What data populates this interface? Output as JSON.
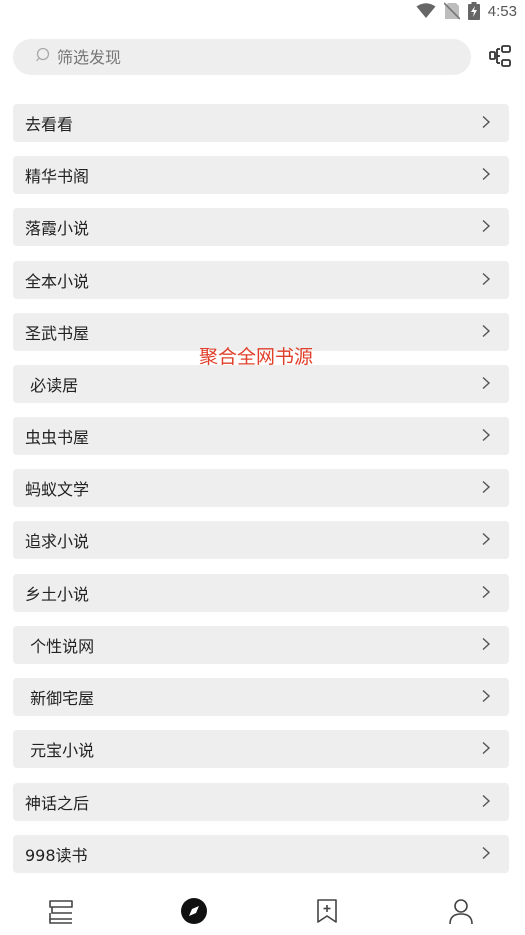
{
  "status_bar": {
    "time": "4:53",
    "icons": [
      "wifi-icon",
      "no-sim-icon",
      "battery-charging-icon"
    ]
  },
  "search": {
    "placeholder": "筛选发现",
    "value": ""
  },
  "header": {
    "group_icon": "category-group-icon"
  },
  "overlay_text": "聚合全网书源",
  "list": {
    "items": [
      {
        "label": "去看看"
      },
      {
        "label": "精华书阁"
      },
      {
        "label": "落霞小说"
      },
      {
        "label": "全本小说"
      },
      {
        "label": "圣武书屋"
      },
      {
        "label": " 必读居"
      },
      {
        "label": "虫虫书屋"
      },
      {
        "label": "蚂蚁文学"
      },
      {
        "label": "追求小说"
      },
      {
        "label": "乡土小说"
      },
      {
        "label": " 个性说网"
      },
      {
        "label": " 新御宅屋"
      },
      {
        "label": " 元宝小说"
      },
      {
        "label": "神话之后"
      },
      {
        "label": "998读书"
      }
    ]
  },
  "bottom_nav": {
    "items": [
      {
        "icon": "bookshelf-icon",
        "active": false
      },
      {
        "icon": "compass-icon",
        "active": true
      },
      {
        "icon": "rss-bookmark-icon",
        "active": false
      },
      {
        "icon": "profile-icon",
        "active": false
      }
    ]
  },
  "colors": {
    "item_background": "#eeeeee",
    "overlay_text": "#e0402a",
    "icon": "#555555"
  }
}
